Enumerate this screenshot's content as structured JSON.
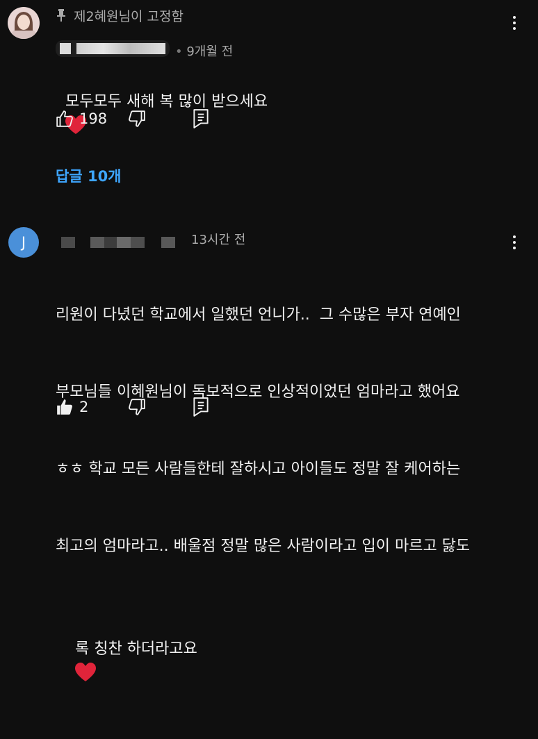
{
  "comments": [
    {
      "pinned_label": "제2혜원님이 고정함",
      "time": "9개월 전",
      "text": "모두모두 새해 복 많이 받으세요",
      "likes": "198",
      "replies_label": "답글 10개"
    },
    {
      "avatar_letter": "J",
      "time": "13시간 전",
      "lines": [
        "리원이 다녔던 학교에서 일했던 언니가..  그 수많은 부자 연예인",
        "부모님들 이혜원님이 독보적으로 인상적이었던 엄마라고 했어요",
        "ㅎㅎ 학교 모든 사람들한테 잘하시고 아이들도 정말 잘 케어하는",
        "최고의 엄마라고.. 배울점 정말 많은 사람이라고 입이 마르고 닳도",
        "록 칭찬 하더라고요"
      ],
      "likes": "2"
    }
  ],
  "colors": {
    "background": "#0f0f0f",
    "link": "#3ea6ff",
    "avatar_j": "#4a90d9",
    "heart": "#e0243a"
  },
  "icons": [
    "pin-icon",
    "thumb-up-icon",
    "thumb-down-icon",
    "reply-icon",
    "more-vert-icon",
    "heart-emoji"
  ]
}
